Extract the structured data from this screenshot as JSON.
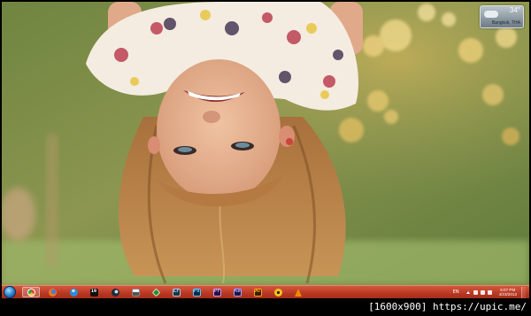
{
  "weather_gadget": {
    "temperature": "34°",
    "location": "Bangkok, THA",
    "icon": "partly-cloudy-icon"
  },
  "taskbar": {
    "start_icon": "windows-start-orb",
    "pinned": [
      {
        "name": "chrome",
        "icon": "chrome-icon",
        "active": true,
        "glyph": "",
        "bg": "#e04a2f",
        "fg": "#ffffff"
      },
      {
        "name": "firefox",
        "icon": "firefox-icon",
        "active": false,
        "glyph": "",
        "bg": "#f07a1a",
        "fg": "#ffffff"
      },
      {
        "name": "internet-explorer",
        "icon": "internet-explorer-icon",
        "active": false,
        "glyph": "e",
        "bg": "#2a8fd8",
        "fg": "#ffffff"
      },
      {
        "name": "game-19",
        "icon": "game-icon",
        "active": false,
        "glyph": "19",
        "bg": "#111111",
        "fg": "#ffffff"
      },
      {
        "name": "steam",
        "icon": "steam-icon",
        "active": false,
        "glyph": "",
        "bg": "#1e2a3a",
        "fg": "#d0d8e0"
      },
      {
        "name": "calculator",
        "icon": "calculator-icon",
        "active": false,
        "glyph": "",
        "bg": "#f2f2f2",
        "fg": "#333333"
      },
      {
        "name": "green-app",
        "icon": "green-app-icon",
        "active": false,
        "glyph": "",
        "bg": "#2f8d2f",
        "fg": "#ffffff"
      },
      {
        "name": "lightroom",
        "icon": "lightroom-icon",
        "active": false,
        "glyph": "Lr",
        "bg": "#22323d",
        "fg": "#9fc8e8"
      },
      {
        "name": "photoshop",
        "icon": "photoshop-icon",
        "active": false,
        "glyph": "Ps",
        "bg": "#0c2b48",
        "fg": "#5ec4f5"
      },
      {
        "name": "premiere",
        "icon": "premiere-icon",
        "active": false,
        "glyph": "Pr",
        "bg": "#2a0f3d",
        "fg": "#c99bf2"
      },
      {
        "name": "after-effects",
        "icon": "after-effects-icon",
        "active": false,
        "glyph": "Ae",
        "bg": "#1b1740",
        "fg": "#a79cf7"
      },
      {
        "name": "illustrator",
        "icon": "illustrator-icon",
        "active": false,
        "glyph": "Ai",
        "bg": "#3a1a02",
        "fg": "#f9a41e"
      },
      {
        "name": "yellow-app",
        "icon": "yellow-app-icon",
        "active": false,
        "glyph": "",
        "bg": "#f3c21b",
        "fg": "#222222"
      },
      {
        "name": "vlc",
        "icon": "vlc-icon",
        "active": false,
        "glyph": "",
        "bg": "#ef8b00",
        "fg": "#ffffff"
      }
    ],
    "tray": {
      "language": "EN",
      "time": "5:07 PM",
      "date": "4/23/2013"
    }
  },
  "caption": "[1600x900] https://upic.me/"
}
